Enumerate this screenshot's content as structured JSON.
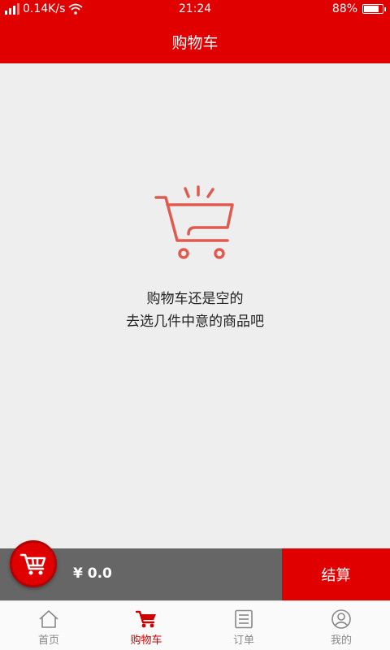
{
  "status_bar": {
    "network_speed": "0.14K/s",
    "time": "21:24",
    "battery": "88%",
    "battery_level": 0.88
  },
  "header": {
    "title": "购物车"
  },
  "empty_state": {
    "line1": "购物车还是空的",
    "line2": "去选几件中意的商品吧"
  },
  "checkout": {
    "total": "¥ 0.0",
    "button_label": "结算"
  },
  "tabs": [
    {
      "label": "首页",
      "icon": "home-icon"
    },
    {
      "label": "购物车",
      "icon": "cart-icon",
      "active": true
    },
    {
      "label": "订单",
      "icon": "order-list-icon"
    },
    {
      "label": "我的",
      "icon": "user-icon"
    }
  ],
  "colors": {
    "brand": "#e00000",
    "empty_cart_icon": "#e05a4f",
    "checkout_bar": "#666666",
    "background": "#eeeeee"
  }
}
